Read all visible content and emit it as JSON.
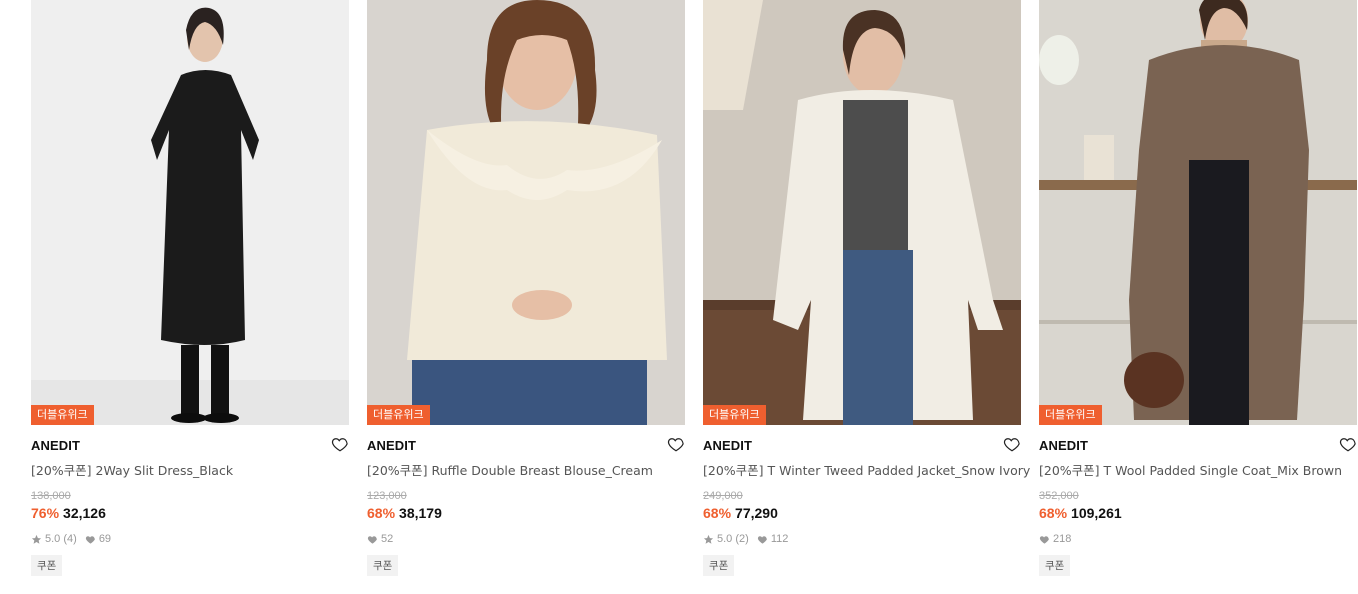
{
  "products": [
    {
      "badge": "더블유위크",
      "brand": "ANEDIT",
      "name": "[20%쿠폰] 2Way Slit Dress_Black",
      "original_price": "138,000",
      "discount": "76%",
      "price": "32,126",
      "rating": "5.0",
      "reviews": "(4)",
      "likes": "69",
      "coupon": "쿠폰",
      "image": "woman-black-slit-dress-photo"
    },
    {
      "badge": "더블유위크",
      "brand": "ANEDIT",
      "name": "[20%쿠폰] Ruffle Double Breast Blouse_Cream",
      "original_price": "123,000",
      "discount": "68%",
      "price": "38,179",
      "likes": "52",
      "coupon": "쿠폰",
      "image": "woman-cream-ruffle-blouse-photo"
    },
    {
      "badge": "더블유위크",
      "brand": "ANEDIT",
      "name": "[20%쿠폰] T Winter Tweed Padded Jacket_Snow Ivory",
      "original_price": "249,000",
      "discount": "68%",
      "price": "77,290",
      "rating": "5.0",
      "reviews": "(2)",
      "likes": "112",
      "coupon": "쿠폰",
      "image": "woman-ivory-tweed-jacket-photo"
    },
    {
      "badge": "더블유위크",
      "brand": "ANEDIT",
      "name": "[20%쿠폰] T Wool Padded Single Coat_Mix Brown",
      "original_price": "352,000",
      "discount": "68%",
      "price": "109,261",
      "likes": "218",
      "coupon": "쿠폰",
      "image": "woman-brown-wool-coat-photo"
    }
  ],
  "colors": {
    "accent": "#ef5f2f",
    "badge_bg": "#ef5f2f",
    "muted_text": "#999999"
  }
}
